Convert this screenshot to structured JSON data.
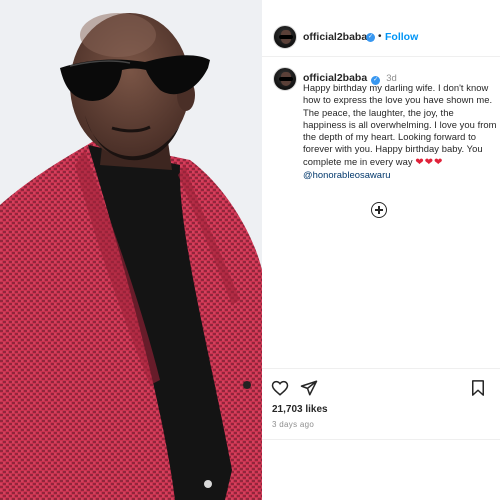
{
  "post": {
    "image_alt": "Man in sunglasses wearing a red tweed jacket and black shirt",
    "author": {
      "username": "official2baba",
      "verified_icon": "verified-badge-icon",
      "verified_glyph": "✓"
    },
    "header": {
      "separator": "•",
      "follow_label": "Follow"
    },
    "caption": {
      "username": "official2baba",
      "time_ago": "3d",
      "text": "Happy birthday my darling wife. I don't know how to express the love you have shown me. The peace, the laughter, the joy, the happiness is all overwhelming. I love you from the depth of my heart. Looking forward to forever with you. Happy birthday baby. You complete me in every way",
      "hearts": "❤❤❤",
      "mention": "@honorableosawaru"
    },
    "actions": {
      "like_icon": "heart-outline-icon",
      "share_icon": "paper-plane-icon",
      "save_icon": "bookmark-icon",
      "add_comment_icon": "plus-circle-icon"
    },
    "likes_text": "21,703 likes",
    "date_text": "3 days ago",
    "colors": {
      "follow": "#0095f6",
      "verified": "#3897f0",
      "mention": "#00376b",
      "hearts": "#e0223a",
      "jacket": "#c8324f"
    }
  }
}
